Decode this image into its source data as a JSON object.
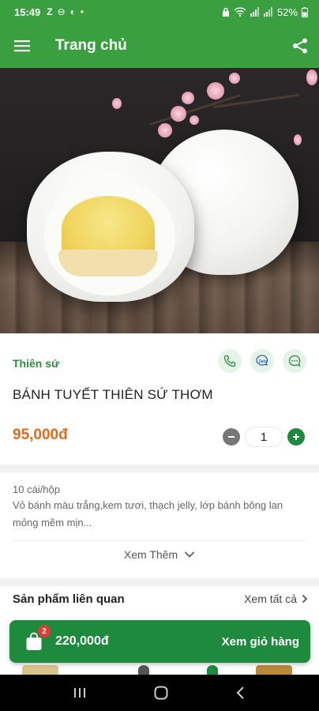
{
  "status_bar": {
    "time": "15:49",
    "left_icons": [
      "Z",
      "⊖",
      "◐",
      "•"
    ],
    "battery": "52%"
  },
  "app_bar": {
    "title": "Trang chủ",
    "menu_icon": "hamburger-icon",
    "share_icon": "share-icon"
  },
  "product": {
    "brand": "Thiên sứ",
    "name": "BÁNH TUYẾT THIÊN SỨ THƠM",
    "price": "95,000đ",
    "quantity": "1",
    "contact_icons": [
      "phone-icon",
      "zalo-icon",
      "chat-icon"
    ]
  },
  "description": {
    "lines": [
      "10 cái/hộp",
      "Vỏ bánh màu trắng,kem tươi, thạch jelly, lớp bánh bông lan",
      "mỏng mềm mịn..."
    ],
    "see_more": "Xem Thêm"
  },
  "related": {
    "title": "Sản phẩm liên quan",
    "view_all": "Xem tất cả"
  },
  "cart": {
    "badge": "2",
    "total": "220,000đ",
    "action": "Xem giỏ hàng"
  },
  "colors": {
    "primary": "#3aa03f",
    "dark_green": "#1e8a3e",
    "price": "#e06b1f"
  }
}
